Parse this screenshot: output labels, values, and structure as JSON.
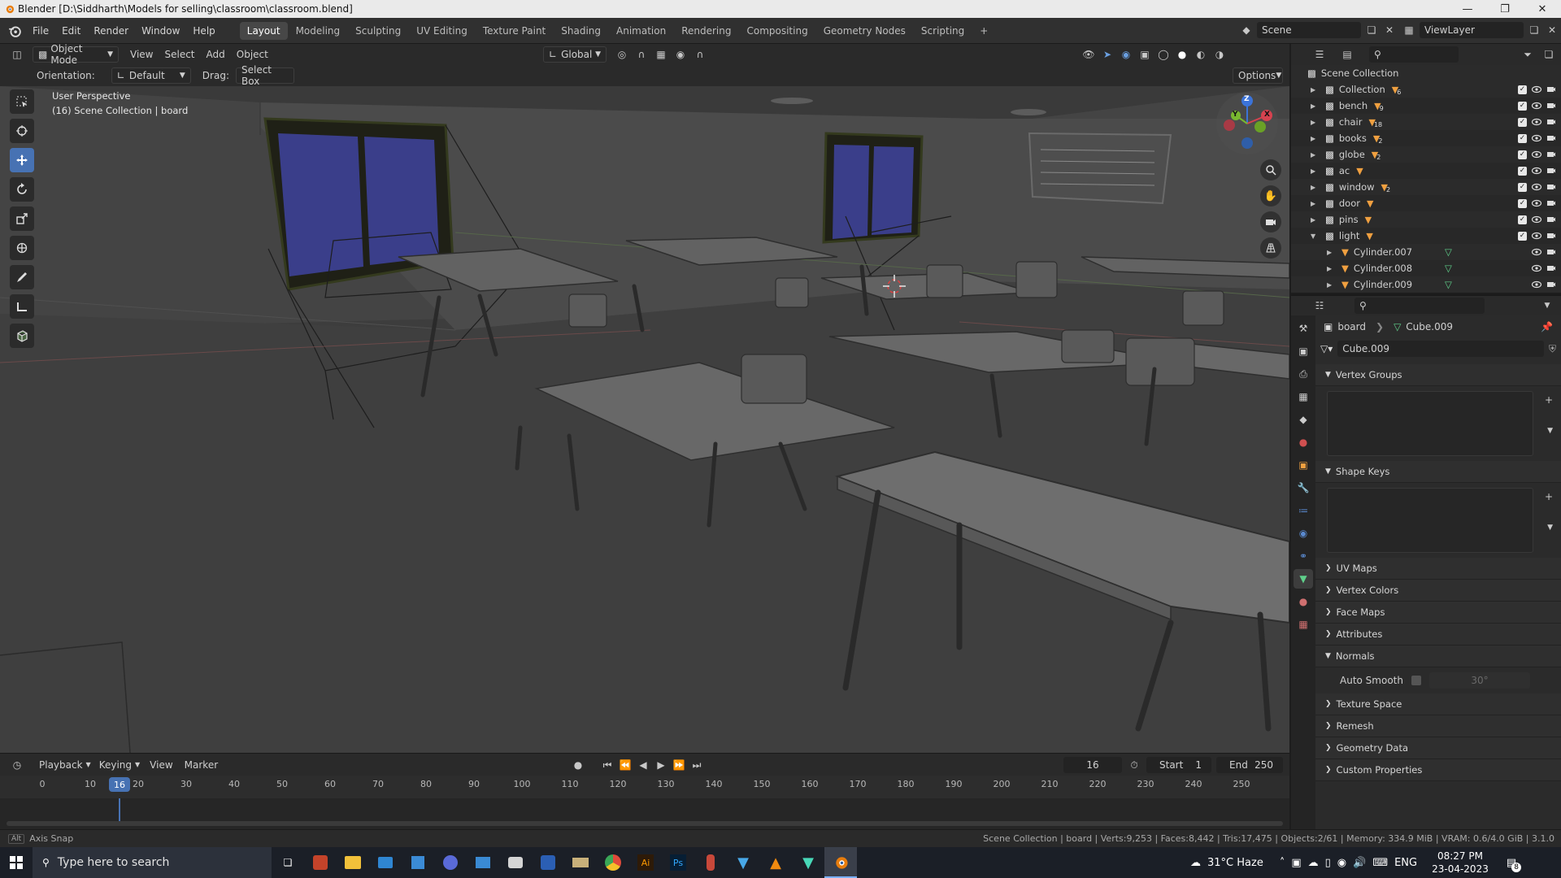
{
  "window": {
    "title": "Blender [D:\\Siddharth\\Models for selling\\classroom\\classroom.blend]"
  },
  "menu": {
    "items": [
      "File",
      "Edit",
      "Render",
      "Window",
      "Help"
    ]
  },
  "workspaces": {
    "tabs": [
      "Layout",
      "Modeling",
      "Sculpting",
      "UV Editing",
      "Texture Paint",
      "Shading",
      "Animation",
      "Rendering",
      "Compositing",
      "Geometry Nodes",
      "Scripting"
    ],
    "active": "Layout"
  },
  "scene": {
    "name": "Scene",
    "view_layer": "ViewLayer"
  },
  "viewport_header": {
    "mode": "Object Mode",
    "view": "View",
    "select": "Select",
    "add": "Add",
    "object": "Object",
    "transform": "Global"
  },
  "tool_settings": {
    "orientation_label": "Orientation:",
    "orientation_value": "Default",
    "drag_label": "Drag:",
    "drag_value": "Select Box",
    "options": "Options"
  },
  "viewport": {
    "perspective": "User Perspective",
    "context": "(16) Scene Collection | board"
  },
  "gizmo": {
    "z": "Z",
    "y": "Y",
    "x": "X"
  },
  "outliner": {
    "root": "Scene Collection",
    "items": [
      {
        "name": "Collection",
        "count": "6"
      },
      {
        "name": "bench",
        "count": "9"
      },
      {
        "name": "chair",
        "count": "18"
      },
      {
        "name": "books",
        "count": "2"
      },
      {
        "name": "globe",
        "count": "2"
      },
      {
        "name": "ac",
        "count": ""
      },
      {
        "name": "window",
        "count": "2"
      },
      {
        "name": "door",
        "count": ""
      },
      {
        "name": "pins",
        "count": ""
      },
      {
        "name": "light",
        "count": ""
      }
    ],
    "children": [
      "Cylinder.007",
      "Cylinder.008",
      "Cylinder.009"
    ]
  },
  "properties": {
    "breadcrumb_object": "board",
    "breadcrumb_data": "Cube.009",
    "data_name": "Cube.009",
    "panels": {
      "vertex_groups": "Vertex Groups",
      "shape_keys": "Shape Keys",
      "uv_maps": "UV Maps",
      "vertex_colors": "Vertex Colors",
      "face_maps": "Face Maps",
      "attributes": "Attributes",
      "normals": "Normals",
      "auto_smooth": "Auto Smooth",
      "auto_smooth_angle": "30°",
      "texture_space": "Texture Space",
      "remesh": "Remesh",
      "geometry_data": "Geometry Data",
      "custom_properties": "Custom Properties"
    }
  },
  "timeline": {
    "playback": "Playback",
    "keying": "Keying",
    "view": "View",
    "marker": "Marker",
    "current_frame": "16",
    "start_label": "Start",
    "start": "1",
    "end_label": "End",
    "end": "250",
    "ticks": [
      "0",
      "10",
      "20",
      "30",
      "40",
      "50",
      "60",
      "70",
      "80",
      "90",
      "100",
      "110",
      "120",
      "130",
      "140",
      "150",
      "160",
      "170",
      "180",
      "190",
      "200",
      "210",
      "220",
      "230",
      "240",
      "250"
    ]
  },
  "statusbar": {
    "hint": "Axis Snap",
    "stats": "Scene Collection | board | Verts:9,253 | Faces:8,442 | Tris:17,475 | Objects:2/61 | Memory: 334.9 MiB | VRAM: 0.6/4.0 GiB | 3.1.0"
  },
  "taskbar": {
    "search_placeholder": "Type here to search",
    "weather": "31°C  Haze",
    "language": "ENG",
    "time": "08:27 PM",
    "date": "23-04-2023",
    "notification_count": "8"
  },
  "colors": {
    "accent": "#4772b3",
    "viewport_bg": "#3d3d3d",
    "panel_bg": "#2b2b2b",
    "window_glass": "#3a3e8a"
  }
}
